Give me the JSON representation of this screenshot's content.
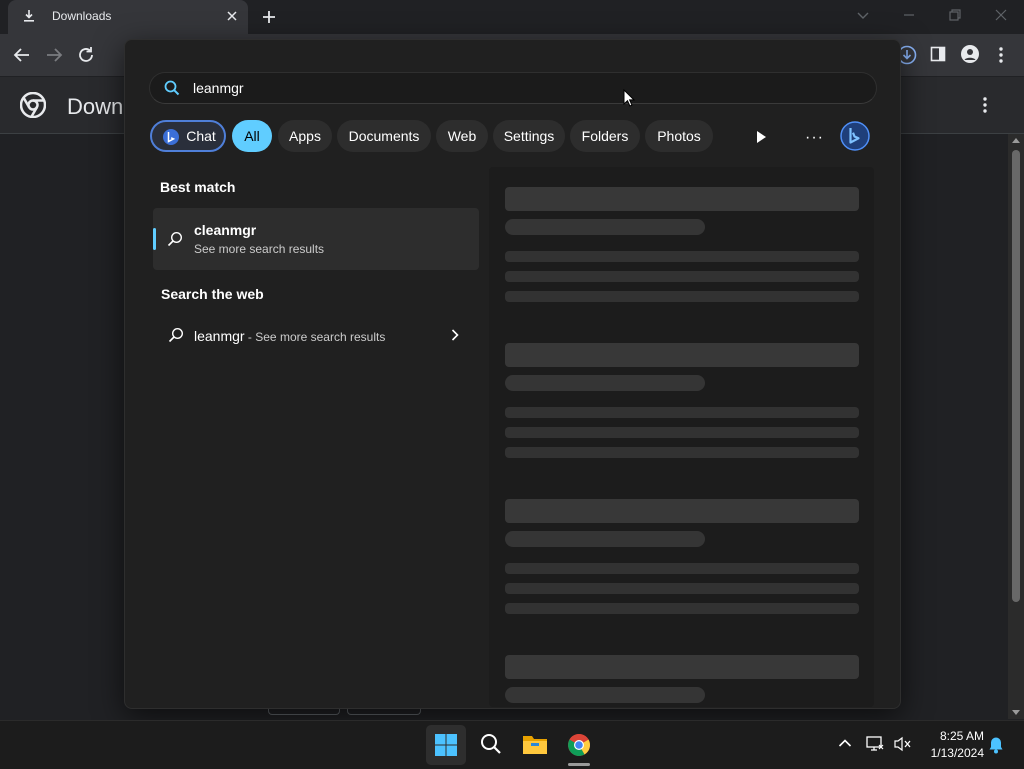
{
  "browser": {
    "tab_title": "Downloads",
    "page_title": "Down"
  },
  "search": {
    "query": "leanmgr",
    "chips": [
      {
        "label": "Chat"
      },
      {
        "label": "All"
      },
      {
        "label": "Apps"
      },
      {
        "label": "Documents"
      },
      {
        "label": "Web"
      },
      {
        "label": "Settings"
      },
      {
        "label": "Folders"
      },
      {
        "label": "Photos"
      }
    ],
    "more_label": "···",
    "best_match_heading": "Best match",
    "best_match": {
      "title": "cleanmgr",
      "subtitle": "See more search results"
    },
    "web_heading": "Search the web",
    "web_result": {
      "query": "leanmgr",
      "suffix": " - See more search results"
    }
  },
  "taskbar": {
    "time": "8:25 AM",
    "date": "1/13/2024"
  },
  "colors": {
    "accent": "#60cdff",
    "flyout_bg": "#202020",
    "chip_bg": "#2d2d2d",
    "chat_border": "#4f7fd9"
  },
  "icons": [
    "download-icon",
    "close-icon",
    "plus-icon",
    "back-icon",
    "forward-icon",
    "reload-icon",
    "downloads-icon",
    "sidepanel-icon",
    "profile-icon",
    "menu-icon",
    "chrome-icon",
    "search-icon",
    "bing-icon",
    "play-icon",
    "chevron-right-icon",
    "windows-icon",
    "file-explorer-icon",
    "chevron-up-icon",
    "network-icon",
    "volume-muted-icon",
    "notification-bell-icon"
  ]
}
